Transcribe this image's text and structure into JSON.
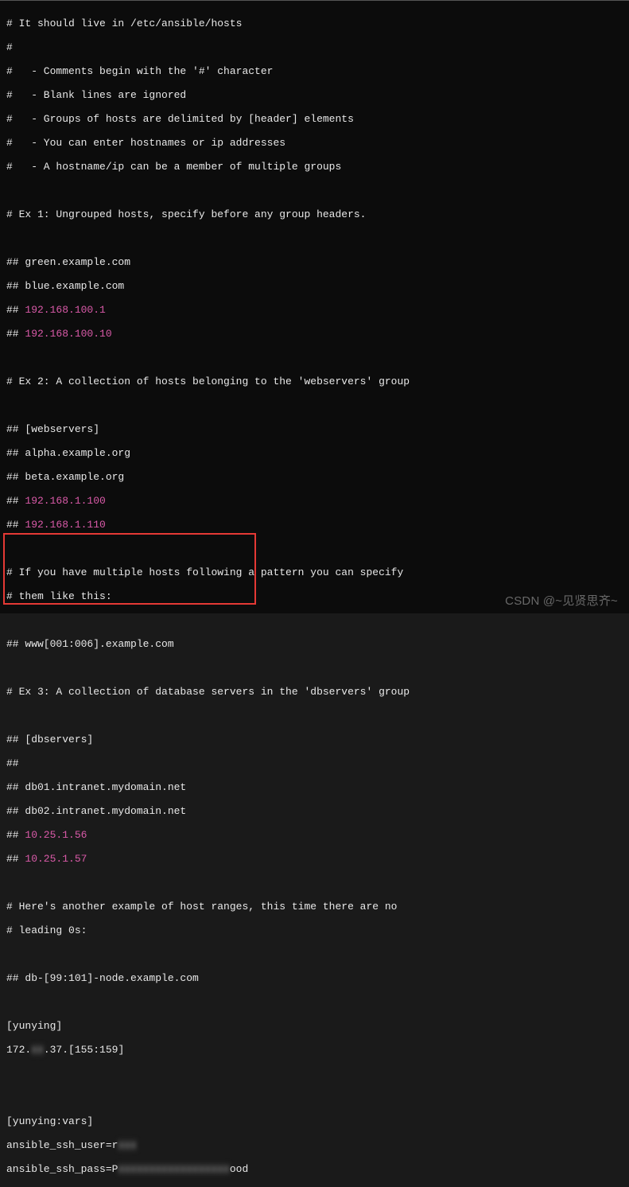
{
  "lines": {
    "l1": "# It should live in /etc/ansible/hosts",
    "l2": "#",
    "l3": "#   - Comments begin with the '#' character",
    "l4": "#   - Blank lines are ignored",
    "l5": "#   - Groups of hosts are delimited by [header] elements",
    "l6": "#   - You can enter hostnames or ip addresses",
    "l7": "#   - A hostname/ip can be a member of multiple groups",
    "l8": "",
    "l9": "# Ex 1: Ungrouped hosts, specify before any group headers.",
    "l10": "",
    "l11": "## green.example.com",
    "l12": "## blue.example.com",
    "l13a": "## ",
    "l13b": "192.168.100.1",
    "l14a": "## ",
    "l14b": "192.168.100.10",
    "l15": "",
    "l16": "# Ex 2: A collection of hosts belonging to the 'webservers' group",
    "l17": "",
    "l18": "## [webservers]",
    "l19": "## alpha.example.org",
    "l20": "## beta.example.org",
    "l21a": "## ",
    "l21b": "192.168.1.100",
    "l22a": "## ",
    "l22b": "192.168.1.110",
    "l23": "",
    "l24": "# If you have multiple hosts following a pattern you can specify",
    "l25": "# them like this:",
    "l26": "",
    "l27": "## www[001:006].example.com",
    "l28": "",
    "l29": "# Ex 3: A collection of database servers in the 'dbservers' group",
    "l30": "",
    "l31": "## [dbservers]",
    "l32": "## ",
    "l33": "## db01.intranet.mydomain.net",
    "l34": "## db02.intranet.mydomain.net",
    "l35a": "## ",
    "l35b": "10.25.1.56",
    "l36a": "## ",
    "l36b": "10.25.1.57",
    "l37": "",
    "l38": "# Here's another example of host ranges, this time there are no",
    "l39": "# leading 0s:",
    "l40": "",
    "l41": "## db-[99:101]-node.example.com",
    "l42": "",
    "l43": "[yunying]",
    "l44a": "172.",
    "l44b": "xx",
    "l44c": ".37.[155:159]",
    "l45": "",
    "l46": "",
    "l47": "[yunying:vars]",
    "l48a": "ansible_ssh_user=r",
    "l48b": "xxx",
    "l49a": "ansible_ssh_pass=P",
    "l49b": "xxxxxxxxxxxxxxxxxx",
    "l49c": "ood"
  },
  "watermark": "CSDN @~见贤思齐~"
}
